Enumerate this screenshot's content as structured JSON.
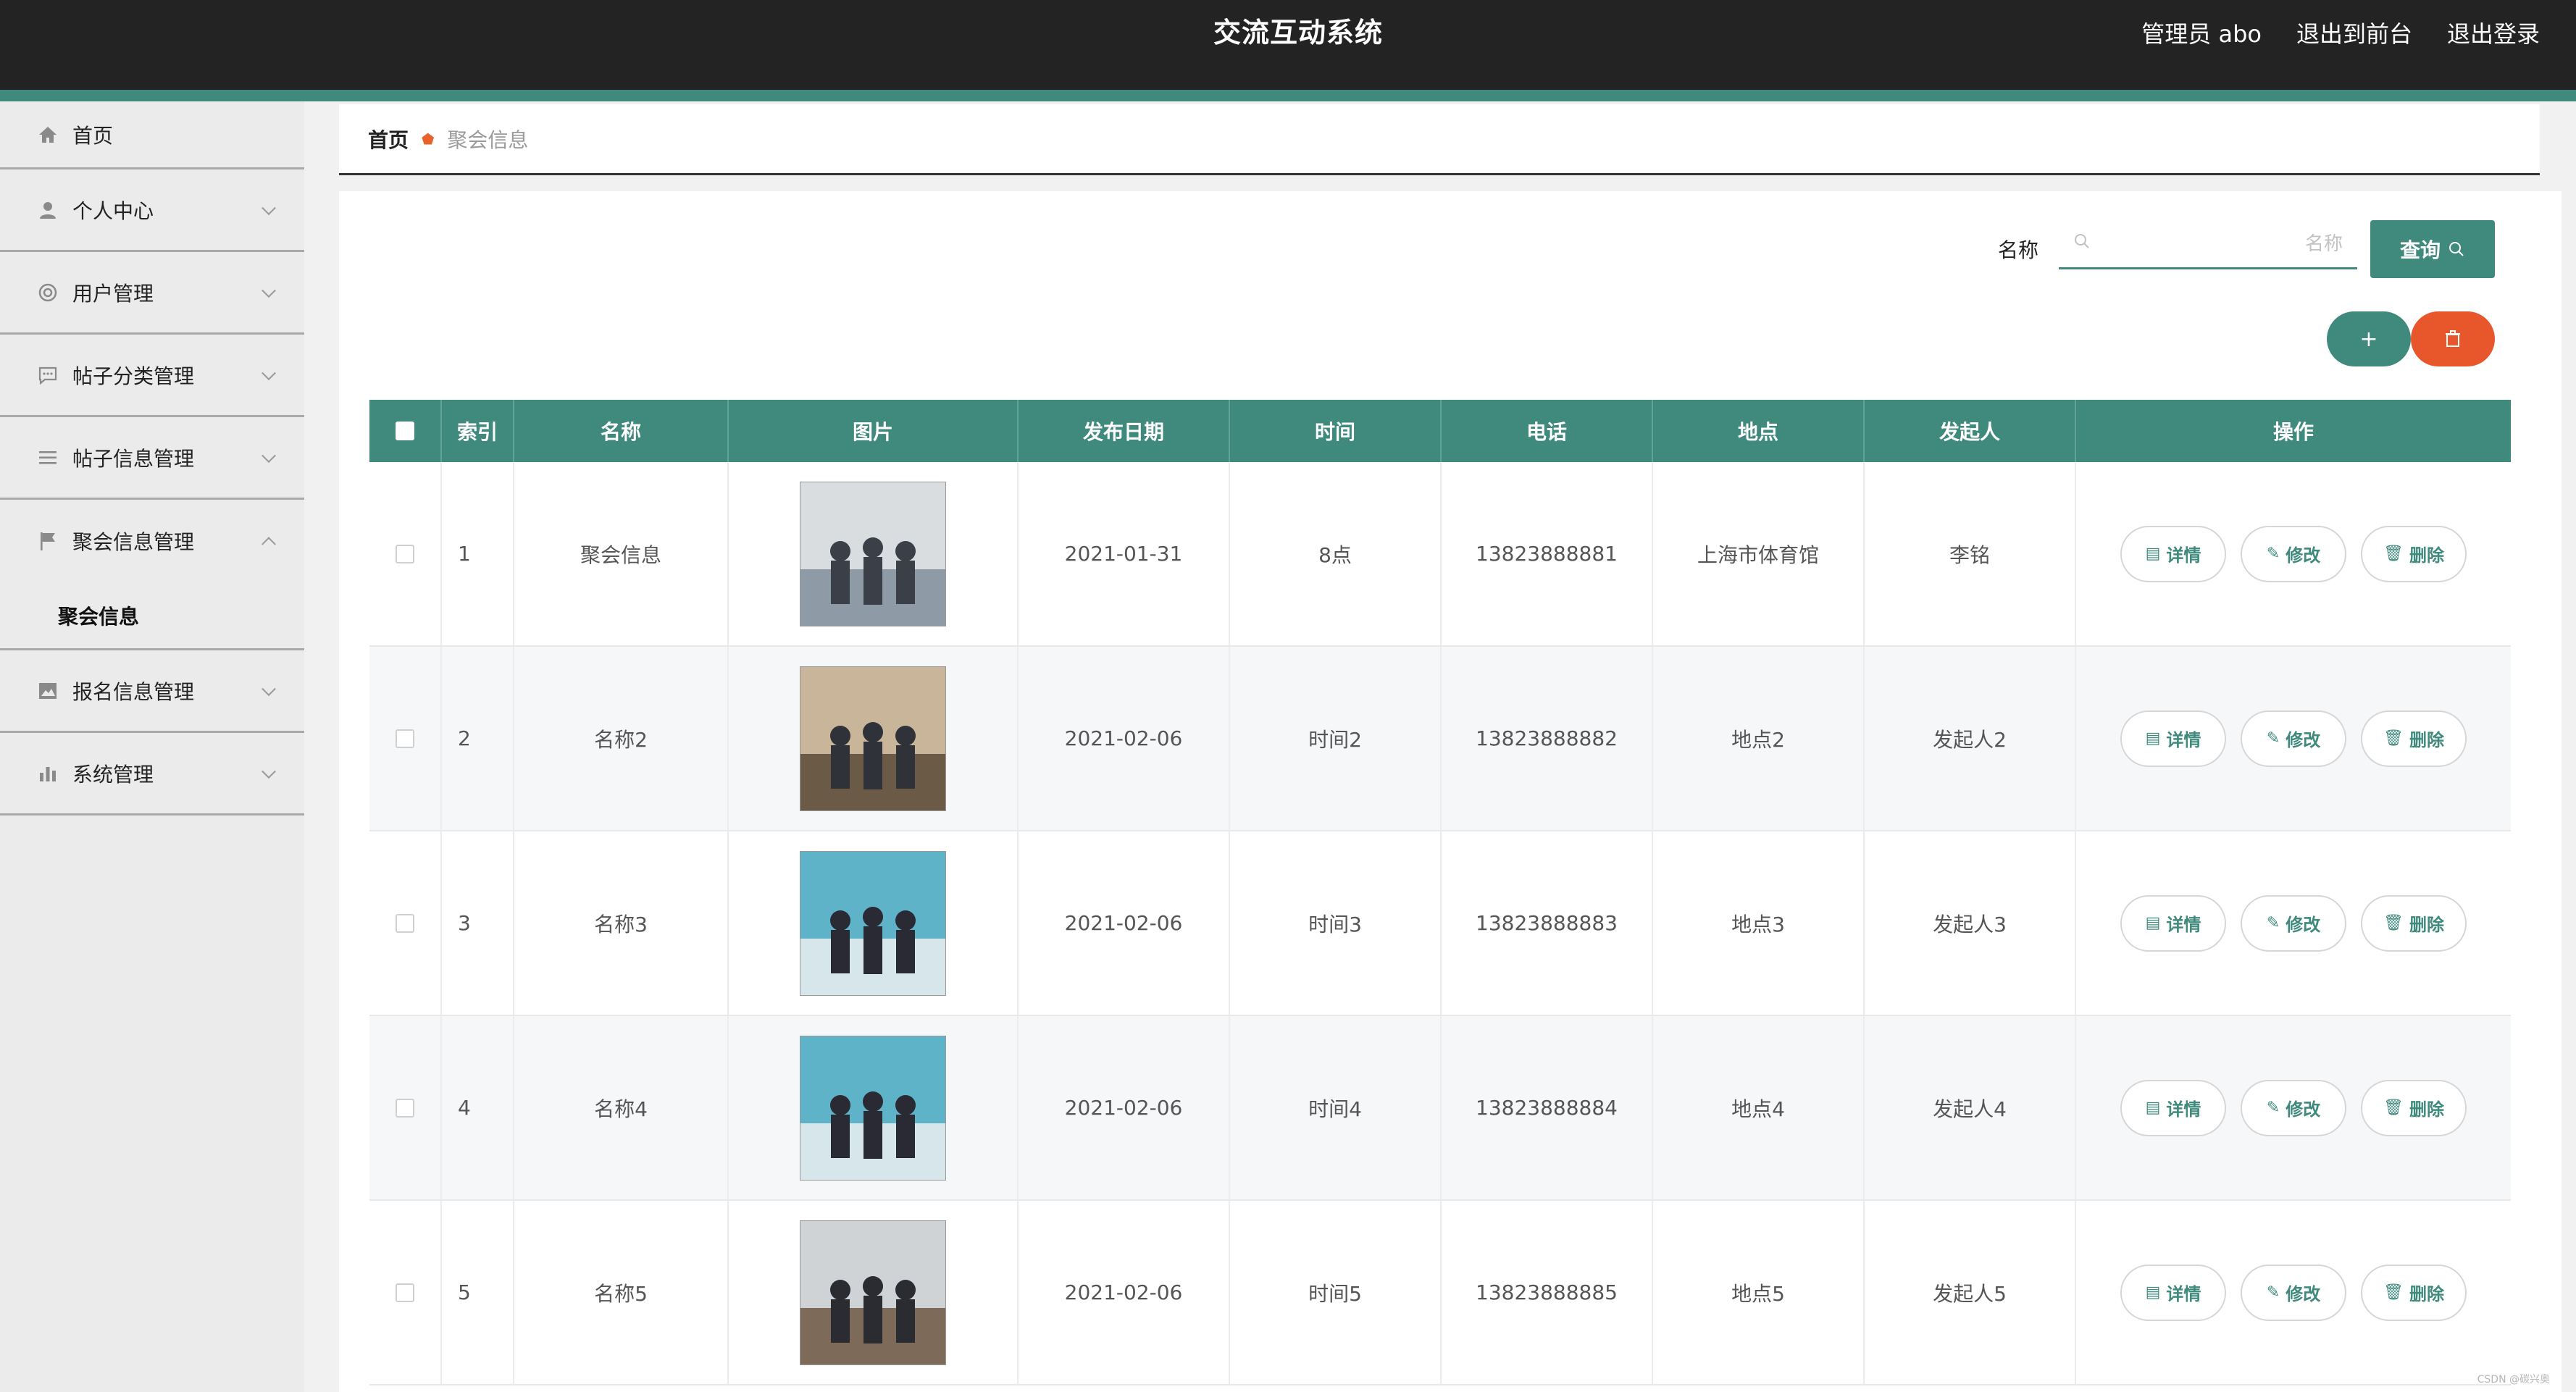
{
  "header": {
    "title": "交流互动系统",
    "user": "管理员 abo",
    "to_front": "退出到前台",
    "logout": "退出登录"
  },
  "sidebar": {
    "items": [
      {
        "label": "首页",
        "icon": "home-icon"
      },
      {
        "label": "个人中心",
        "icon": "user-icon"
      },
      {
        "label": "用户管理",
        "icon": "users-icon"
      },
      {
        "label": "帖子分类管理",
        "icon": "chat-icon"
      },
      {
        "label": "帖子信息管理",
        "icon": "list-icon"
      },
      {
        "label": "聚会信息管理",
        "icon": "flag-icon"
      },
      {
        "label": "报名信息管理",
        "icon": "picture-icon"
      },
      {
        "label": "系统管理",
        "icon": "chart-icon"
      }
    ],
    "sub_item": "聚会信息"
  },
  "breadcrumb": {
    "home": "首页",
    "current": "聚会信息"
  },
  "search": {
    "label": "名称",
    "placeholder": "名称",
    "button": "查询",
    "add": "+",
    "delete": "🗑"
  },
  "table": {
    "columns": [
      "",
      "索引",
      "名称",
      "图片",
      "发布日期",
      "时间",
      "电话",
      "地点",
      "发起人",
      "操作"
    ],
    "rows": [
      {
        "index": "1",
        "name": "聚会信息",
        "date": "2021-01-31",
        "time": "8点",
        "phone": "13823888881",
        "place": "上海市体育馆",
        "organizer": "李铭"
      },
      {
        "index": "2",
        "name": "名称2",
        "date": "2021-02-06",
        "time": "时间2",
        "phone": "13823888882",
        "place": "地点2",
        "organizer": "发起人2"
      },
      {
        "index": "3",
        "name": "名称3",
        "date": "2021-02-06",
        "time": "时间3",
        "phone": "13823888883",
        "place": "地点3",
        "organizer": "发起人3"
      },
      {
        "index": "4",
        "name": "名称4",
        "date": "2021-02-06",
        "time": "时间4",
        "phone": "13823888884",
        "place": "地点4",
        "organizer": "发起人4"
      },
      {
        "index": "5",
        "name": "名称5",
        "date": "2021-02-06",
        "time": "时间5",
        "phone": "13823888885",
        "place": "地点5",
        "organizer": "发起人5"
      }
    ],
    "actions": {
      "detail": "详情",
      "edit": "修改",
      "remove": "删除"
    }
  },
  "watermark": "CSDN @碳兴奥",
  "colors": {
    "primary": "#3f8a7d",
    "danger": "#e8572c",
    "topbar": "#232323"
  }
}
